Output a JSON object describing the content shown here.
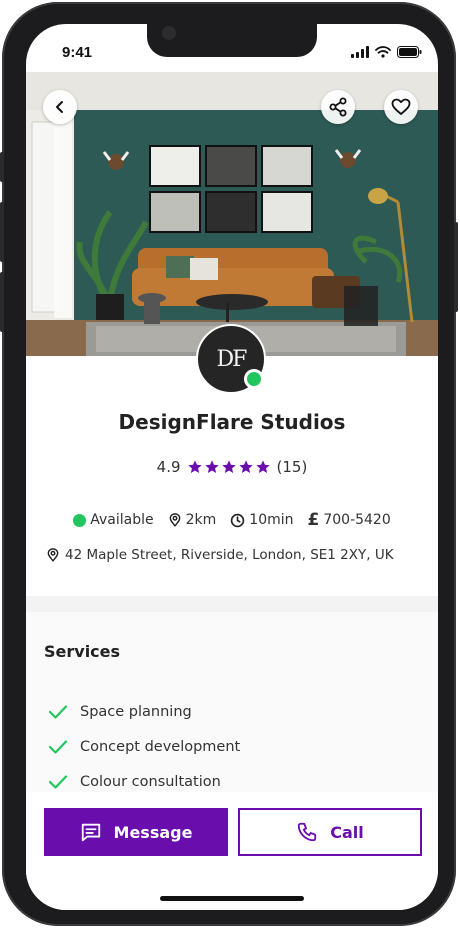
{
  "status_bar": {
    "time": "9:41"
  },
  "hero": {
    "back_icon": "chevron-left-icon",
    "share_icon": "share-icon",
    "favorite_icon": "heart-icon"
  },
  "profile": {
    "initials": "DF",
    "name": "DesignFlare Studios",
    "rating": "4.9",
    "stars": 5,
    "review_count": "(15)",
    "online_color": "#22c55e"
  },
  "meta": {
    "availability": "Available",
    "distance": "2km",
    "time": "10min",
    "currency_symbol": "£",
    "phone": "700-5420",
    "address": "42 Maple Street, Riverside, London, SE1 2XY, UK"
  },
  "services": {
    "title": "Services",
    "items": [
      "Space planning",
      "Concept development",
      "Colour consultation"
    ]
  },
  "actions": {
    "message_label": "Message",
    "call_label": "Call"
  },
  "colors": {
    "accent": "#6a0dad",
    "star": "#6a0dad",
    "check": "#22c55e"
  }
}
